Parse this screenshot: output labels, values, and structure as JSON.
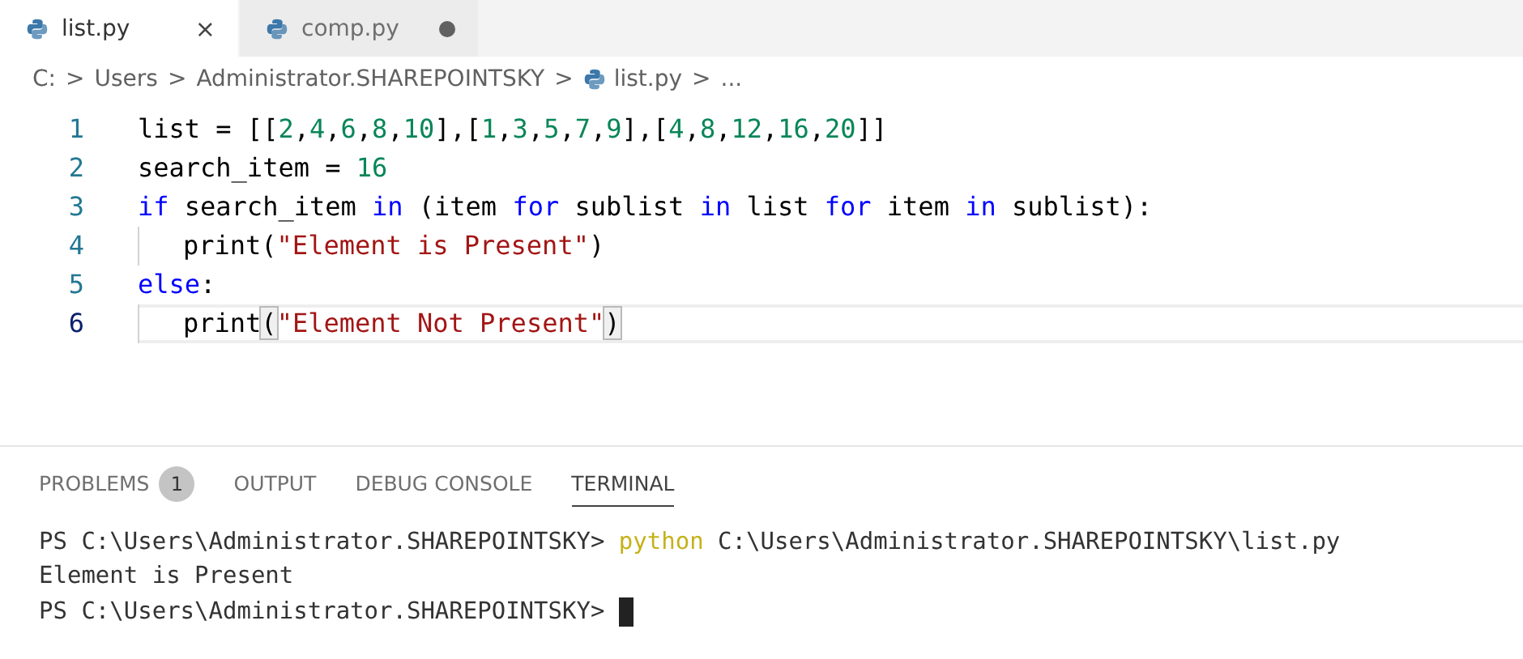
{
  "tabs": [
    {
      "label": "list.py",
      "selected": true,
      "close": "×",
      "modified": false
    },
    {
      "label": "comp.py",
      "selected": false,
      "modified": true
    }
  ],
  "breadcrumb": [
    {
      "label": "C:",
      "kind": "folder"
    },
    {
      "label": "Users",
      "kind": "folder"
    },
    {
      "label": "Administrator.SHAREPOINTSKY",
      "kind": "folder"
    },
    {
      "label": "list.py",
      "kind": "file"
    },
    {
      "label": "...",
      "kind": "more"
    }
  ],
  "breadcrumb_separator": ">",
  "code": [
    {
      "number": "1",
      "current": false,
      "tokens": [
        {
          "t": "list = [[",
          "kind": "plain"
        },
        {
          "t": "2",
          "kind": "num"
        },
        {
          "t": ",",
          "kind": "plain"
        },
        {
          "t": "4",
          "kind": "num"
        },
        {
          "t": ",",
          "kind": "plain"
        },
        {
          "t": "6",
          "kind": "num"
        },
        {
          "t": ",",
          "kind": "plain"
        },
        {
          "t": "8",
          "kind": "num"
        },
        {
          "t": ",",
          "kind": "plain"
        },
        {
          "t": "10",
          "kind": "num"
        },
        {
          "t": "],[",
          "kind": "plain"
        },
        {
          "t": "1",
          "kind": "num"
        },
        {
          "t": ",",
          "kind": "plain"
        },
        {
          "t": "3",
          "kind": "num"
        },
        {
          "t": ",",
          "kind": "plain"
        },
        {
          "t": "5",
          "kind": "num"
        },
        {
          "t": ",",
          "kind": "plain"
        },
        {
          "t": "7",
          "kind": "num"
        },
        {
          "t": ",",
          "kind": "plain"
        },
        {
          "t": "9",
          "kind": "num"
        },
        {
          "t": "],[",
          "kind": "plain"
        },
        {
          "t": "4",
          "kind": "num"
        },
        {
          "t": ",",
          "kind": "plain"
        },
        {
          "t": "8",
          "kind": "num"
        },
        {
          "t": ",",
          "kind": "plain"
        },
        {
          "t": "12",
          "kind": "num"
        },
        {
          "t": ",",
          "kind": "plain"
        },
        {
          "t": "16",
          "kind": "num"
        },
        {
          "t": ",",
          "kind": "plain"
        },
        {
          "t": "20",
          "kind": "num"
        },
        {
          "t": "]]",
          "kind": "plain"
        }
      ]
    },
    {
      "number": "2",
      "current": false,
      "tokens": [
        {
          "t": "search_item = ",
          "kind": "plain"
        },
        {
          "t": "16",
          "kind": "num"
        }
      ]
    },
    {
      "number": "3",
      "current": false,
      "tokens": [
        {
          "t": "if",
          "kind": "kw"
        },
        {
          "t": " search_item ",
          "kind": "plain"
        },
        {
          "t": "in",
          "kind": "kw"
        },
        {
          "t": " (item ",
          "kind": "plain"
        },
        {
          "t": "for",
          "kind": "kw"
        },
        {
          "t": " sublist ",
          "kind": "plain"
        },
        {
          "t": "in",
          "kind": "kw"
        },
        {
          "t": " list ",
          "kind": "plain"
        },
        {
          "t": "for",
          "kind": "kw"
        },
        {
          "t": " item ",
          "kind": "plain"
        },
        {
          "t": "in",
          "kind": "kw"
        },
        {
          "t": " sublist):",
          "kind": "plain"
        }
      ],
      "children": [
        {
          "number": "4",
          "current": false,
          "tokens": [
            {
              "t": "print(",
              "kind": "plain"
            },
            {
              "t": "\"Element is Present\"",
              "kind": "str"
            },
            {
              "t": ")",
              "kind": "plain"
            }
          ]
        }
      ]
    },
    {
      "number": "5",
      "current": false,
      "tokens": [
        {
          "t": "else",
          "kind": "kw"
        },
        {
          "t": ":",
          "kind": "plain"
        }
      ],
      "children": [
        {
          "number": "6",
          "current": true,
          "tokens": [
            {
              "t": "print",
              "kind": "plain"
            },
            {
              "t": "(",
              "kind": "bracket"
            },
            {
              "t": "\"Element Not Present\"",
              "kind": "str"
            },
            {
              "t": ")",
              "kind": "bracket"
            }
          ]
        }
      ]
    }
  ],
  "panel_tabs": [
    {
      "label": "PROBLEMS",
      "selected": false,
      "badge": "1"
    },
    {
      "label": "OUTPUT",
      "selected": false
    },
    {
      "label": "DEBUG CONSOLE",
      "selected": false
    },
    {
      "label": "TERMINAL",
      "selected": true
    }
  ],
  "terminal": [
    {
      "cursor": false,
      "segments": [
        {
          "t": "PS C:\\Users\\Administrator.SHAREPOINTSKY> ",
          "kind": "plain"
        },
        {
          "t": "python",
          "kind": "cmd"
        },
        {
          "t": " C:\\Users\\Administrator.SHAREPOINTSKY\\list.py",
          "kind": "plain"
        }
      ]
    },
    {
      "cursor": false,
      "segments": [
        {
          "t": "Element is Present",
          "kind": "plain"
        }
      ]
    },
    {
      "cursor": true,
      "segments": [
        {
          "t": "PS C:\\Users\\Administrator.SHAREPOINTSKY> ",
          "kind": "plain"
        }
      ]
    }
  ]
}
